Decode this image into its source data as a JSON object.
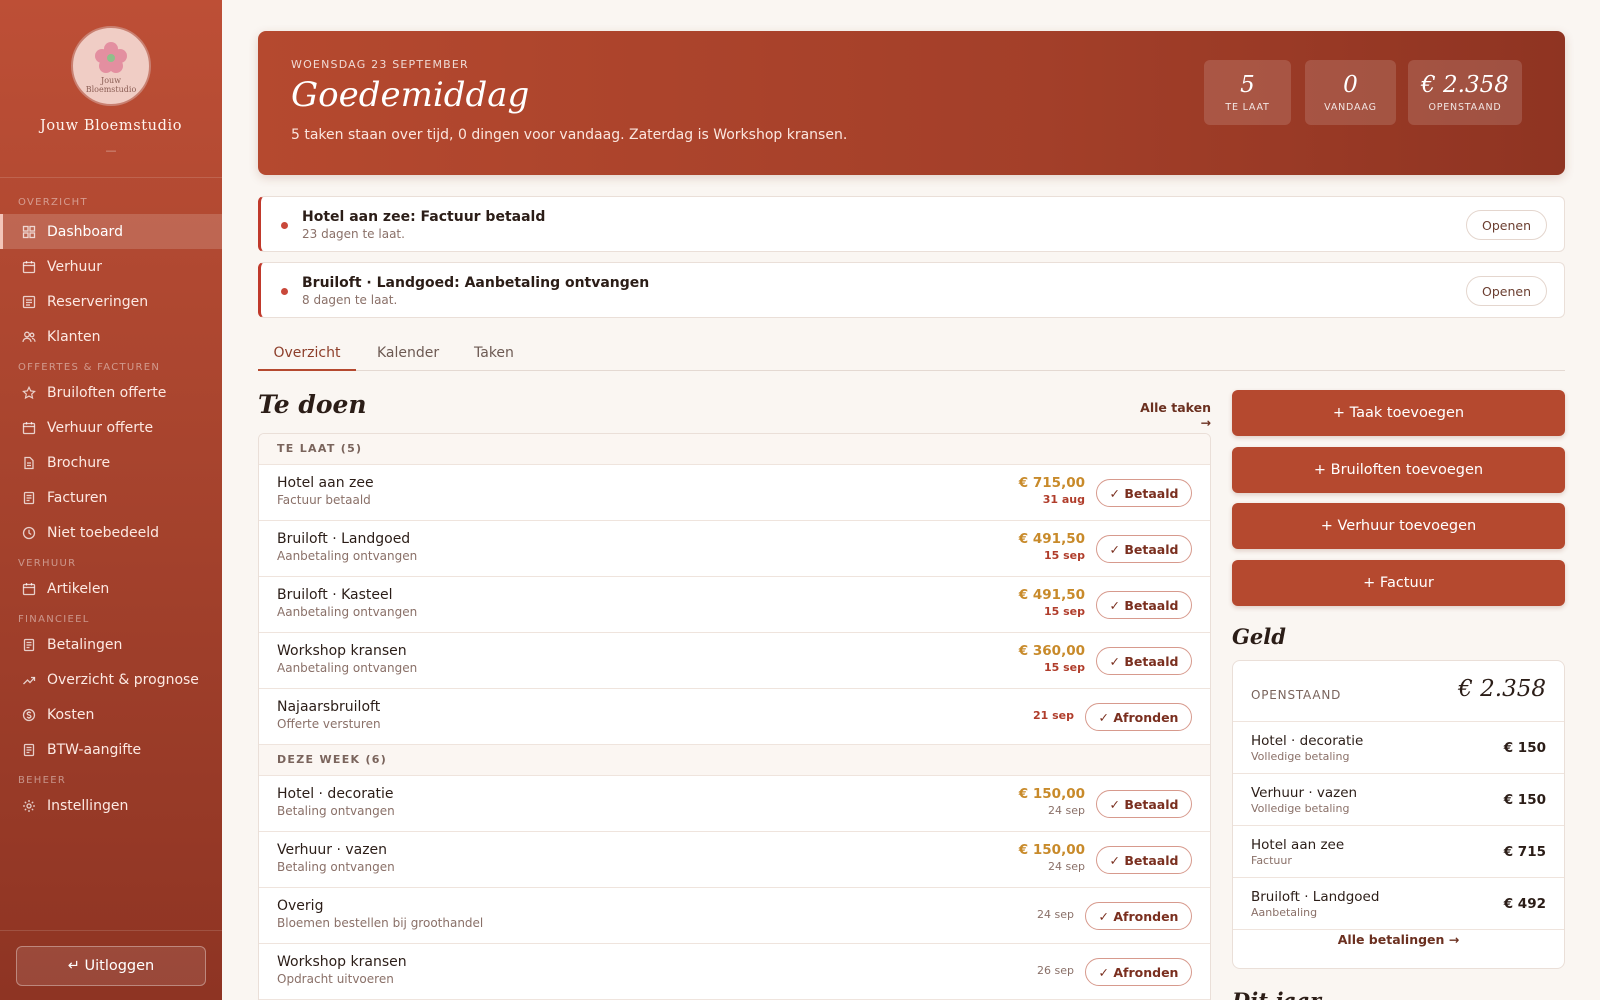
{
  "brand": {
    "name": "Jouw Bloemstudio",
    "logo_line1": "Jouw",
    "logo_line2": "Bloemstudio",
    "dash": "—"
  },
  "sidebar": {
    "sections": [
      {
        "label": "OVERZICHT",
        "items": [
          {
            "label": "Dashboard",
            "icon": "grid-icon",
            "active": true
          },
          {
            "label": "Verhuur",
            "icon": "calendar-icon"
          },
          {
            "label": "Reserveringen",
            "icon": "list-icon"
          },
          {
            "label": "Klanten",
            "icon": "users-icon"
          }
        ]
      },
      {
        "label": "OFFERTES & FACTUREN",
        "items": [
          {
            "label": "Bruiloften offerte",
            "icon": "star-icon"
          },
          {
            "label": "Verhuur offerte",
            "icon": "calendar-icon"
          },
          {
            "label": "Brochure",
            "icon": "document-icon"
          },
          {
            "label": "Facturen",
            "icon": "invoice-icon"
          },
          {
            "label": "Niet toebedeeld",
            "icon": "clock-icon"
          }
        ]
      },
      {
        "label": "VERHUUR",
        "items": [
          {
            "label": "Artikelen",
            "icon": "calendar-icon"
          }
        ]
      },
      {
        "label": "FINANCIEEL",
        "items": [
          {
            "label": "Betalingen",
            "icon": "invoice-icon"
          },
          {
            "label": "Overzicht & prognose",
            "icon": "trend-icon"
          },
          {
            "label": "Kosten",
            "icon": "dollar-icon"
          },
          {
            "label": "BTW-aangifte",
            "icon": "invoice-icon"
          }
        ]
      },
      {
        "label": "BEHEER",
        "items": [
          {
            "label": "Instellingen",
            "icon": "gear-icon"
          }
        ]
      }
    ],
    "logout_label": "↵ Uitloggen"
  },
  "hero": {
    "date": "WOENSDAG 23 SEPTEMBER",
    "greeting": "Goedemiddag",
    "subtitle": "5 taken staan over tijd, 0 dingen voor vandaag. Zaterdag is Workshop kransen.",
    "stats": [
      {
        "value": "5",
        "label": "TE LAAT"
      },
      {
        "value": "0",
        "label": "VANDAAG"
      },
      {
        "value": "€ 2.358",
        "label": "OPENSTAAND"
      }
    ]
  },
  "alerts": [
    {
      "title": "Hotel aan zee: Factuur betaald",
      "subtitle": "23 dagen te laat.",
      "button": "Openen"
    },
    {
      "title": "Bruiloft · Landgoed: Aanbetaling ontvangen",
      "subtitle": "8 dagen te laat.",
      "button": "Openen"
    }
  ],
  "tabs": [
    "Overzicht",
    "Kalender",
    "Taken"
  ],
  "todo": {
    "title": "Te doen",
    "all_link": "Alle taken →",
    "groups": [
      {
        "label": "TE LAAT (5)",
        "rows": [
          {
            "name": "Hotel aan zee",
            "sub": "Factuur betaald",
            "amount": "€ 715,00",
            "date": "31 aug",
            "late": true,
            "action": "✓ Betaald"
          },
          {
            "name": "Bruiloft · Landgoed",
            "sub": "Aanbetaling ontvangen",
            "amount": "€ 491,50",
            "date": "15 sep",
            "late": true,
            "action": "✓ Betaald"
          },
          {
            "name": "Bruiloft · Kasteel",
            "sub": "Aanbetaling ontvangen",
            "amount": "€ 491,50",
            "date": "15 sep",
            "late": true,
            "action": "✓ Betaald"
          },
          {
            "name": "Workshop kransen",
            "sub": "Aanbetaling ontvangen",
            "amount": "€ 360,00",
            "date": "15 sep",
            "late": true,
            "action": "✓ Betaald"
          },
          {
            "name": "Najaarsbruiloft",
            "sub": "Offerte versturen",
            "amount": "",
            "date": "21 sep",
            "late": true,
            "action": "✓ Afronden"
          }
        ]
      },
      {
        "label": "DEZE WEEK (6)",
        "rows": [
          {
            "name": "Hotel · decoratie",
            "sub": "Betaling ontvangen",
            "amount": "€ 150,00",
            "date": "24 sep",
            "late": false,
            "action": "✓ Betaald"
          },
          {
            "name": "Verhuur · vazen",
            "sub": "Betaling ontvangen",
            "amount": "€ 150,00",
            "date": "24 sep",
            "late": false,
            "action": "✓ Betaald"
          },
          {
            "name": "Overig",
            "sub": "Bloemen bestellen bij groothandel",
            "amount": "",
            "date": "24 sep",
            "late": false,
            "action": "✓ Afronden"
          },
          {
            "name": "Workshop kransen",
            "sub": "Opdracht uitvoeren",
            "amount": "",
            "date": "26 sep",
            "late": false,
            "action": "✓ Afronden"
          }
        ]
      }
    ]
  },
  "actions": [
    "+ Taak toevoegen",
    "+ Bruiloften toevoegen",
    "+ Verhuur toevoegen",
    "+ Factuur"
  ],
  "geld": {
    "title": "Geld",
    "open_label": "OPENSTAAND",
    "open_value": "€ 2.358",
    "payments": [
      {
        "name": "Hotel · decoratie",
        "sub": "Volledige betaling",
        "amount": "€ 150"
      },
      {
        "name": "Verhuur · vazen",
        "sub": "Volledige betaling",
        "amount": "€ 150"
      },
      {
        "name": "Hotel aan zee",
        "sub": "Factuur",
        "amount": "€ 715"
      },
      {
        "name": "Bruiloft · Landgoed",
        "sub": "Aanbetaling",
        "amount": "€ 492"
      }
    ],
    "all_link": "Alle betalingen →"
  },
  "dit_jaar_title": "Dit jaar",
  "colors": {
    "accent": "#b5492f",
    "sidebar": "#a8442e",
    "amount": "#c88a2a",
    "late": "#b03d2b",
    "background": "#faf6f2"
  }
}
